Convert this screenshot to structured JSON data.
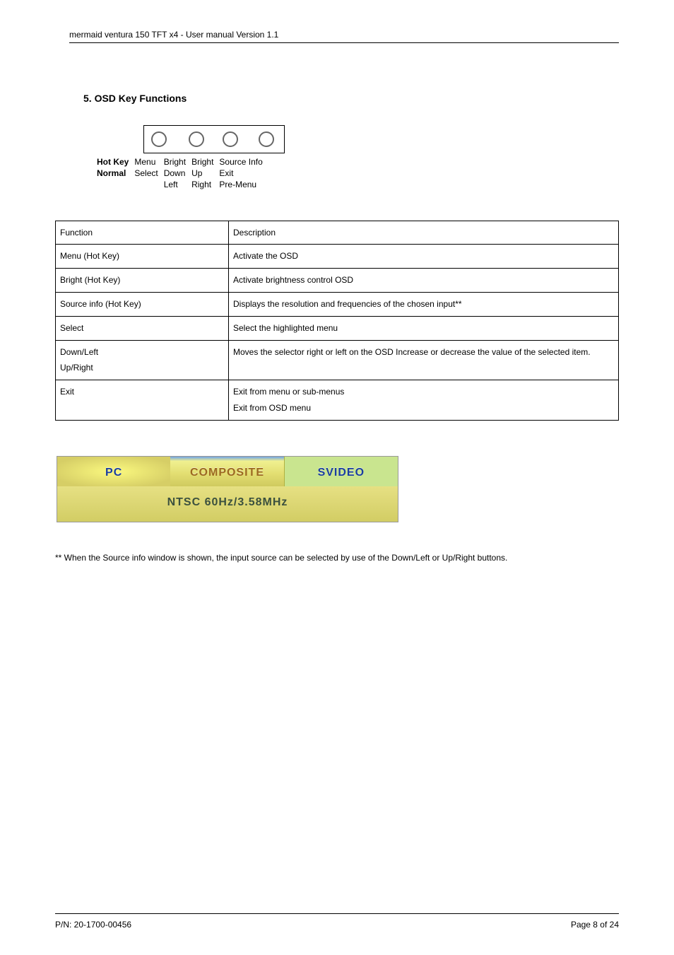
{
  "header": "mermaid ventura 150 TFT x4 - User manual Version 1.1",
  "section_title": "5. OSD Key Functions",
  "button_rows": {
    "hotkey_label": "Hot Key",
    "normal_label": "Normal",
    "cols": [
      {
        "hot": "Menu",
        "normal1": "Select",
        "normal2": ""
      },
      {
        "hot": "Bright",
        "normal1": "Down",
        "normal2": "Left"
      },
      {
        "hot": "Bright",
        "normal1": "Up",
        "normal2": "Right"
      },
      {
        "hot": "Source Info",
        "normal1": "Exit",
        "normal2": "Pre-Menu"
      }
    ]
  },
  "func_table": {
    "head_function": "Function",
    "head_description": "Description",
    "rows": [
      {
        "f": "Menu (Hot Key)",
        "d": "Activate the OSD"
      },
      {
        "f": "Bright (Hot Key)",
        "d": "Activate brightness control OSD"
      },
      {
        "f": "Source info (Hot Key)",
        "d": "Displays the resolution and frequencies of the chosen input**"
      },
      {
        "f": "Select",
        "d": "Select the highlighted menu"
      },
      {
        "f": "Down/Left\nUp/Right",
        "d": "Moves the selector right or left on the OSD Increase or decrease the value of the selected item."
      },
      {
        "f": "Exit",
        "d": "Exit from menu or sub-menus\nExit from OSD menu"
      }
    ]
  },
  "osd": {
    "tabs": [
      "PC",
      "COMPOSITE",
      "SVIDEO"
    ],
    "info": "NTSC 60Hz/3.58MHz"
  },
  "footnote": "** When the Source info window is shown, the input source can be selected by use of the Down/Left or Up/Right buttons.",
  "footer": {
    "left": "P/N: 20-1700-00456",
    "right": "Page 8 of 24"
  }
}
